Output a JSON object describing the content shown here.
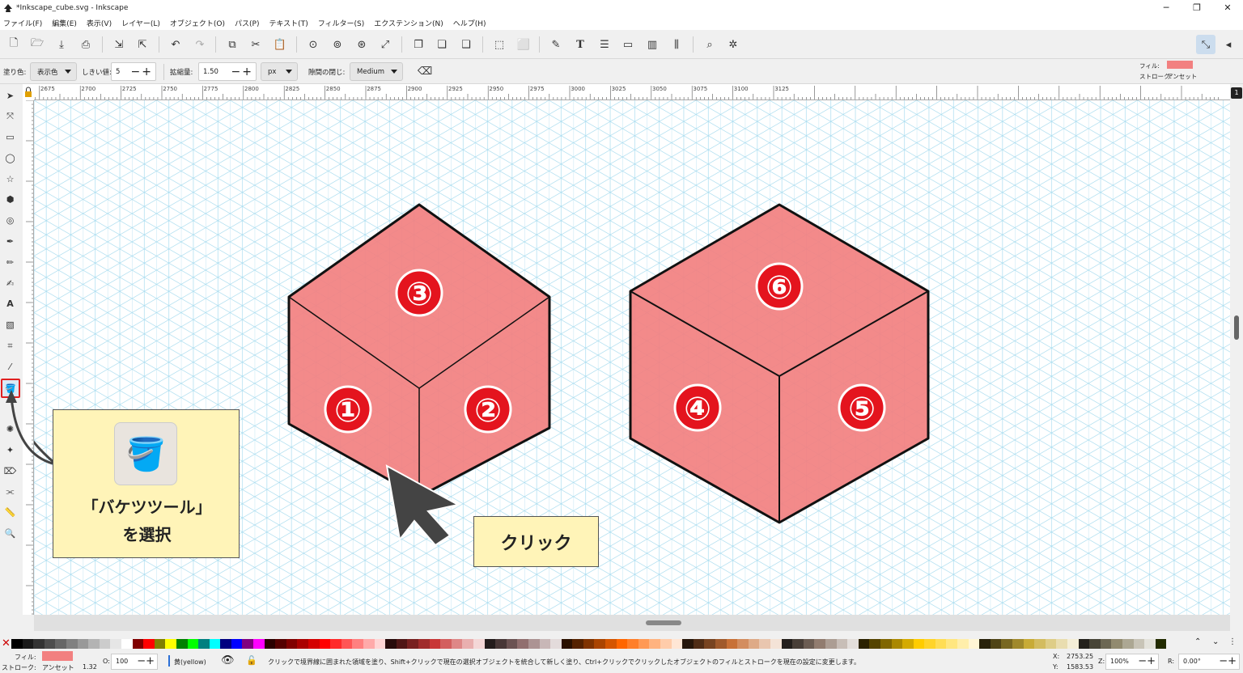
{
  "window": {
    "title": "*Inkscape_cube.svg - Inkscape",
    "controls": [
      "─",
      "❐",
      "✕"
    ]
  },
  "menu": [
    "ファイル(F)",
    "編集(E)",
    "表示(V)",
    "レイヤー(L)",
    "オブジェクト(O)",
    "パス(P)",
    "テキスト(T)",
    "フィルター(S)",
    "エクステンション(N)",
    "ヘルプ(H)"
  ],
  "tool_controls": {
    "fill_label": "塗り色:",
    "fill_value": "表示色",
    "threshold_label": "しきい値:",
    "threshold_value": "5",
    "grow_label": "拡縮量:",
    "grow_value": "1.50",
    "unit_value": "px",
    "close_gaps_label": "隙間の閉じ:",
    "close_gaps_value": "Medium"
  },
  "fill_stroke_indicator": {
    "fill_label": "フィル:",
    "stroke_label": "ストローク:",
    "stroke_value": "アンセット",
    "fill_color": "#f28080"
  },
  "ruler_ticks": [
    "2675",
    "2700",
    "2725",
    "2750",
    "2775",
    "2800",
    "2825",
    "2850",
    "2875",
    "2900",
    "2925",
    "2950",
    "2975",
    "3000",
    "3025",
    "3050",
    "3075",
    "3100",
    "3125"
  ],
  "cubes": [
    {
      "faces": [
        {
          "label": "③"
        },
        {
          "label": "①"
        },
        {
          "label": "②"
        }
      ]
    },
    {
      "faces": [
        {
          "label": "⑥"
        },
        {
          "label": "④"
        },
        {
          "label": "⑤"
        }
      ]
    }
  ],
  "annotations": {
    "tool_callout_line1": "「バケツツール」",
    "tool_callout_line2": "を選択",
    "click_callout": "クリック"
  },
  "status": {
    "fill_label": "フィル:",
    "stroke_label": "ストローク:",
    "stroke_value": "アンセット",
    "stroke_width": "1.32",
    "opacity_label": "O:",
    "opacity_value": "100",
    "layer_name": "黄(yellow)",
    "message": "クリックで境界線に囲まれた領域を塗り、Shift+クリックで現在の選択オブジェクトを統合して新しく塗り、Ctrl+クリックでクリックしたオブジェクトのフィルとストロークを現在の設定に変更します。",
    "x_label": "X:",
    "x_value": "2753.25",
    "y_label": "Y:",
    "y_value": "1583.53",
    "zoom_label": "Z:",
    "zoom_value": "100%",
    "rotate_label": "R:",
    "rotate_value": "0.00°"
  },
  "colors": {
    "face_fill": "#f28080",
    "grid_line": "#a8dcef",
    "callout_bg": "#fff4b8",
    "selected_tool_border": "#e02020",
    "badge_red": "#e4141e"
  },
  "palette_colors": [
    "#000000",
    "#1a1a1a",
    "#333333",
    "#4d4d4d",
    "#666666",
    "#808080",
    "#999999",
    "#b3b3b3",
    "#cccccc",
    "#e6e6e6",
    "#ffffff",
    "#800000",
    "#ff0000",
    "#808000",
    "#ffff00",
    "#008000",
    "#00ff00",
    "#008080",
    "#00ffff",
    "#000080",
    "#0000ff",
    "#800080",
    "#ff00ff",
    "#2b0000",
    "#550000",
    "#800000",
    "#aa0000",
    "#d40000",
    "#ff0000",
    "#ff2a2a",
    "#ff5555",
    "#ff8080",
    "#ffaaaa",
    "#ffd5d5",
    "#280b0b",
    "#501616",
    "#782121",
    "#a02c2c",
    "#c83737",
    "#d35f5f",
    "#de8787",
    "#e9afaf",
    "#f4d7d7",
    "#241c1c",
    "#483737",
    "#6c5353",
    "#916f6f",
    "#ac9393",
    "#c8b7b7",
    "#e3dbdb",
    "#2b1100",
    "#552200",
    "#803300",
    "#aa4400",
    "#d45500",
    "#ff6600",
    "#ff7f2a",
    "#ff9955",
    "#ffb380",
    "#ffccaa",
    "#ffe6d5",
    "#28170b",
    "#502d16",
    "#784421",
    "#a05a2c",
    "#c87137",
    "#d38d5f",
    "#deaa87",
    "#e9c6af",
    "#f4e3d7",
    "#241f1c",
    "#483e37",
    "#6c5d53",
    "#917c6f",
    "#ac9d93",
    "#c8beb7",
    "#e3dedb",
    "#2b2200",
    "#554400",
    "#806600",
    "#aa8800",
    "#d4aa00",
    "#ffcc00",
    "#ffd42a",
    "#ffdd55",
    "#ffe680",
    "#ffeeaa",
    "#fff6d5",
    "#28220b",
    "#504416",
    "#786721",
    "#a0892c",
    "#c8ab37",
    "#d3bc5f",
    "#decd87",
    "#e9ddaf",
    "#f4eed7",
    "#24221c",
    "#484537",
    "#6c6753",
    "#918a6f",
    "#aca793",
    "#c8c4b7",
    "#e3e2db",
    "#222b00"
  ]
}
